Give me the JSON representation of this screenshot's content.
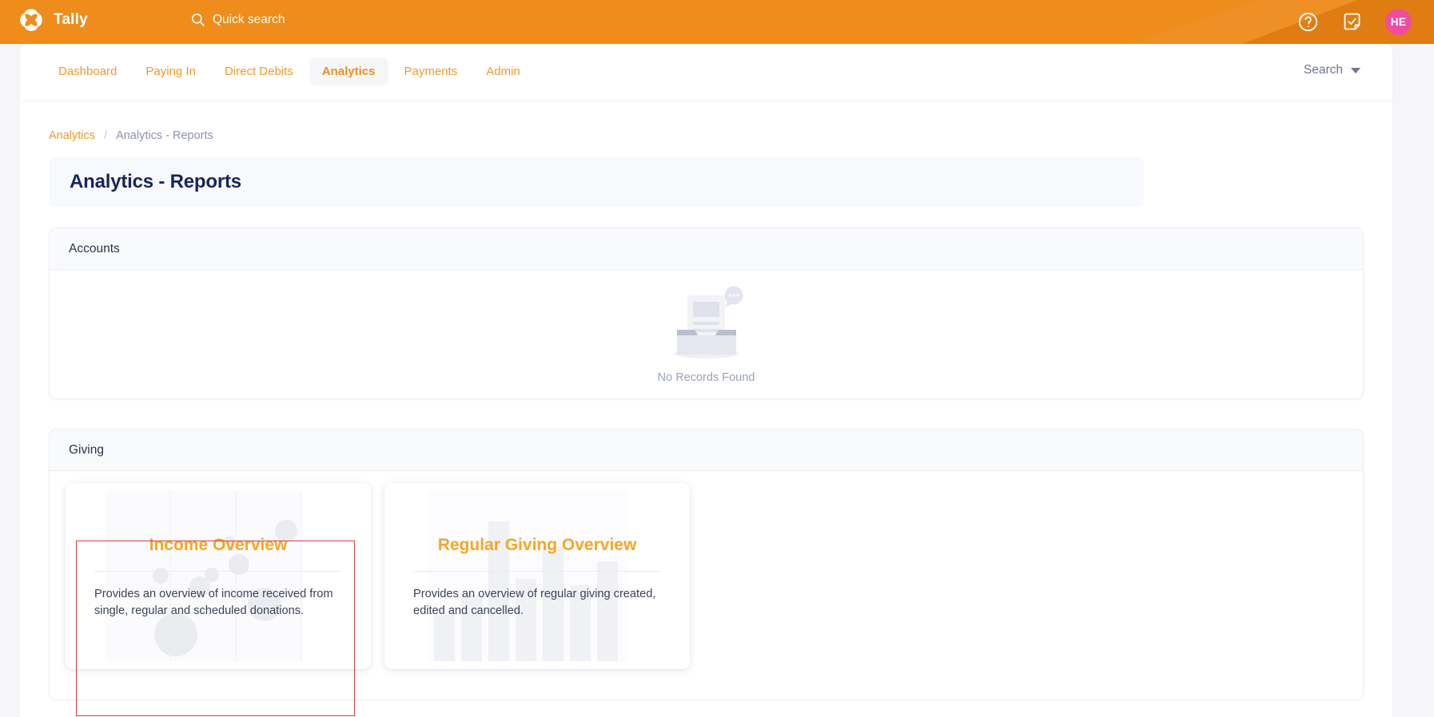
{
  "brand": {
    "name": "Tally",
    "logo_icon": "tally-pinwheel-logo"
  },
  "topbar": {
    "quick_search": {
      "placeholder": "Quick search",
      "icon": "search-icon"
    },
    "help_icon": "help-circle-icon",
    "tasks_icon": "checklist-note-icon",
    "avatar_initials": "HE",
    "avatar_color": "#f04ca0",
    "background_color": "#ee8c1c"
  },
  "nav": {
    "items": [
      {
        "label": "Dashboard",
        "active": false
      },
      {
        "label": "Paying In",
        "active": false
      },
      {
        "label": "Direct Debits",
        "active": false
      },
      {
        "label": "Analytics",
        "active": true
      },
      {
        "label": "Payments",
        "active": false
      },
      {
        "label": "Admin",
        "active": false
      }
    ],
    "search_label": "Search",
    "search_icon": "chevron-down-icon"
  },
  "breadcrumb": {
    "parent": "Analytics",
    "separator": "/",
    "current": "Analytics - Reports"
  },
  "page": {
    "title": "Analytics - Reports"
  },
  "sections": {
    "accounts": {
      "title": "Accounts",
      "empty_text": "No Records Found",
      "empty_icon": "empty-inbox-illustration"
    },
    "giving": {
      "title": "Giving",
      "cards": [
        {
          "title": "Income Overview",
          "description": "Provides an overview of income received from single, regular and scheduled donations.",
          "watermark": "bubble-chart",
          "selected": true
        },
        {
          "title": "Regular Giving Overview",
          "description": "Provides an overview of regular giving created, edited and cancelled.",
          "watermark": "bar-chart",
          "selected": false
        }
      ]
    }
  },
  "colors": {
    "brand_orange": "#ee8c1c",
    "accent_orange": "#f2992b",
    "card_title_orange": "#f6a623",
    "title_navy": "#16255e",
    "selection_red": "#e23b3b"
  }
}
